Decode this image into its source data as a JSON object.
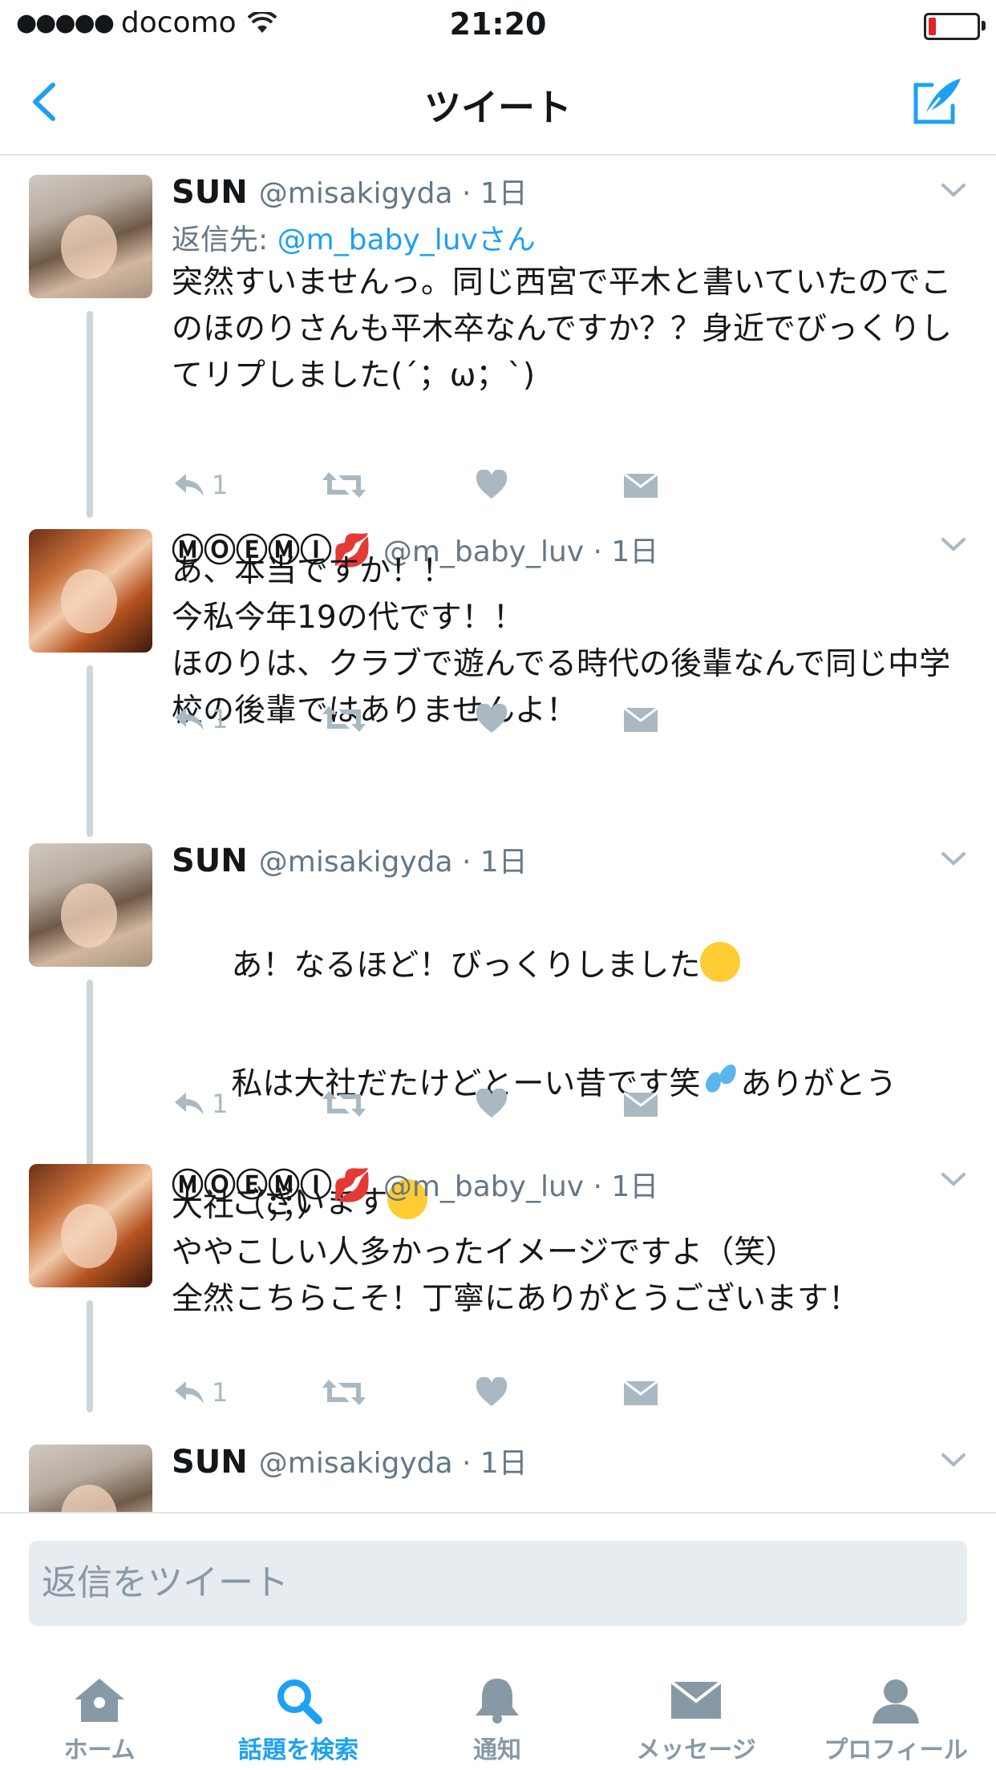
{
  "status_bar": {
    "signal": "●●●●●",
    "carrier": "docomo",
    "time": "21:20"
  },
  "nav": {
    "title": "ツイート"
  },
  "tweets": [
    {
      "name": "SUN",
      "handle": "@misakigyda · 1日",
      "reply_prefix": "返信先: ",
      "reply_to": "@m_baby_luvさん",
      "text": "突然すいませんっ。同じ西宮で平木と書いていたのでこのほのりさんも平木卒なんですか？？身近でびっくりしてリプしました(´；ω；`)",
      "reply_count": "1"
    },
    {
      "name": "ⓂⓄⒺⓂⒾ💋",
      "handle": "@m_baby_luv · 1日",
      "text": "あ、本当ですか！！\n今私今年19の代です！！\nほのりは、クラブで遊んでる時代の後輩なんで同じ中学校の後輩ではありませんよ！",
      "reply_count": "1"
    },
    {
      "name": "SUN",
      "handle": "@misakigyda · 1日",
      "text_line1": "あ！なるほど！びっくりしました",
      "text_line2": "私は大社だたけどとーい昔です笑",
      "text_line2b": "ありがとう",
      "text_line3": "ございます",
      "emoji": [
        "rolling-on-floor-laughing",
        "sweat-droplets",
        "smiling-face"
      ],
      "reply_count": "1"
    },
    {
      "name": "ⓂⓄⒺⓂⒾ💋",
      "handle": "@m_baby_luv · 1日",
      "text": "大社（；；）\nややこしい人多かったイメージですよ（笑）\n全然こちらこそ！丁寧にありがとうございます！",
      "reply_count": "1"
    },
    {
      "name": "SUN",
      "handle": "@misakigyda · 1日"
    }
  ],
  "reply_input": {
    "placeholder": "返信をツイート"
  },
  "tabs": [
    {
      "label": "ホーム",
      "icon": "home-icon"
    },
    {
      "label": "話題を検索",
      "icon": "search-icon",
      "active": true
    },
    {
      "label": "通知",
      "icon": "bell-icon"
    },
    {
      "label": "メッセージ",
      "icon": "envelope-icon"
    },
    {
      "label": "プロフィール",
      "icon": "person-icon"
    }
  ],
  "colors": {
    "accent": "#1da1f2",
    "secondary": "#657786",
    "icon": "#aab8c2"
  }
}
